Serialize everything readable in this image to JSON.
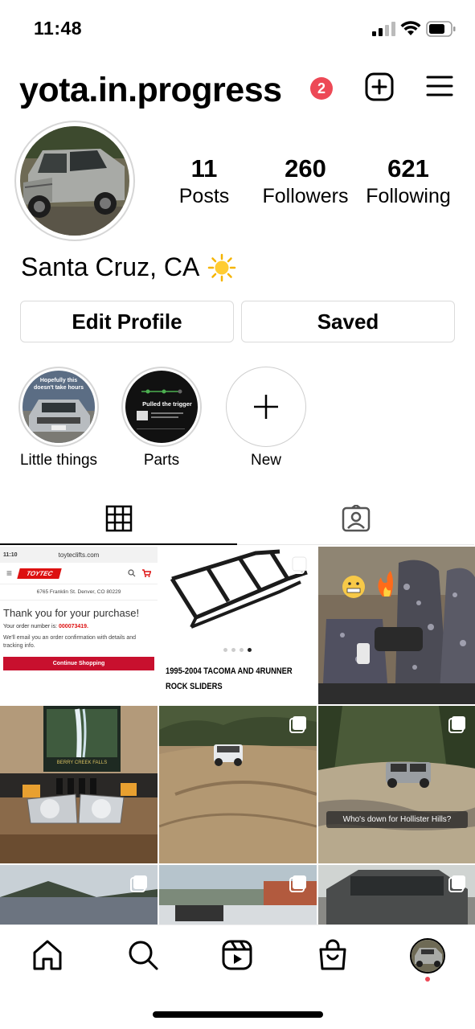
{
  "status_bar": {
    "time": "11:48",
    "icons": [
      "signal-icon",
      "wifi-icon",
      "battery-icon"
    ]
  },
  "header": {
    "username": "yota.in.progress",
    "notification_count": "2",
    "icons": [
      "create-post-icon",
      "menu-icon"
    ]
  },
  "profile": {
    "stats": [
      {
        "value": "11",
        "label": "Posts"
      },
      {
        "value": "260",
        "label": "Followers"
      },
      {
        "value": "621",
        "label": "Following"
      }
    ],
    "bio_name": "Santa Cruz, CA",
    "bio_emoji": "sun-icon"
  },
  "buttons": {
    "edit_profile": "Edit Profile",
    "saved": "Saved"
  },
  "highlights": [
    {
      "label": "Little things",
      "cover_text": "Hopefully this doesn't take hours"
    },
    {
      "label": "Parts",
      "cover_text": "Pulled the trigger"
    },
    {
      "label": "New"
    }
  ],
  "tabs": [
    "grid-icon",
    "tagged-icon"
  ],
  "posts": {
    "receipt": {
      "time": "11:10",
      "url": "toyteclifts.com",
      "logo": "TOYTEC",
      "address": "6765 Franklin St. Denver, CO 80229",
      "thanks": "Thank you for your purchase!",
      "order_label": "Your order number is:",
      "order_number": "000073419.",
      "email_text": "We'll email you an order confirmation with details and tracking info.",
      "button": "Continue Shopping"
    },
    "sliders": {
      "caption": "1995-2004 TACOMA AND 4RUNNER ROCK SLIDERS"
    },
    "offroad_caption": "Who's down for Hollister Hills?",
    "waterfall_caption": "BERRY CREEK FALLS"
  },
  "colors": {
    "accent_red": "#ed4956",
    "border": "#dbdbdb"
  },
  "bottom_nav": [
    "home-icon",
    "search-icon",
    "reels-icon",
    "shop-icon",
    "profile-avatar"
  ]
}
